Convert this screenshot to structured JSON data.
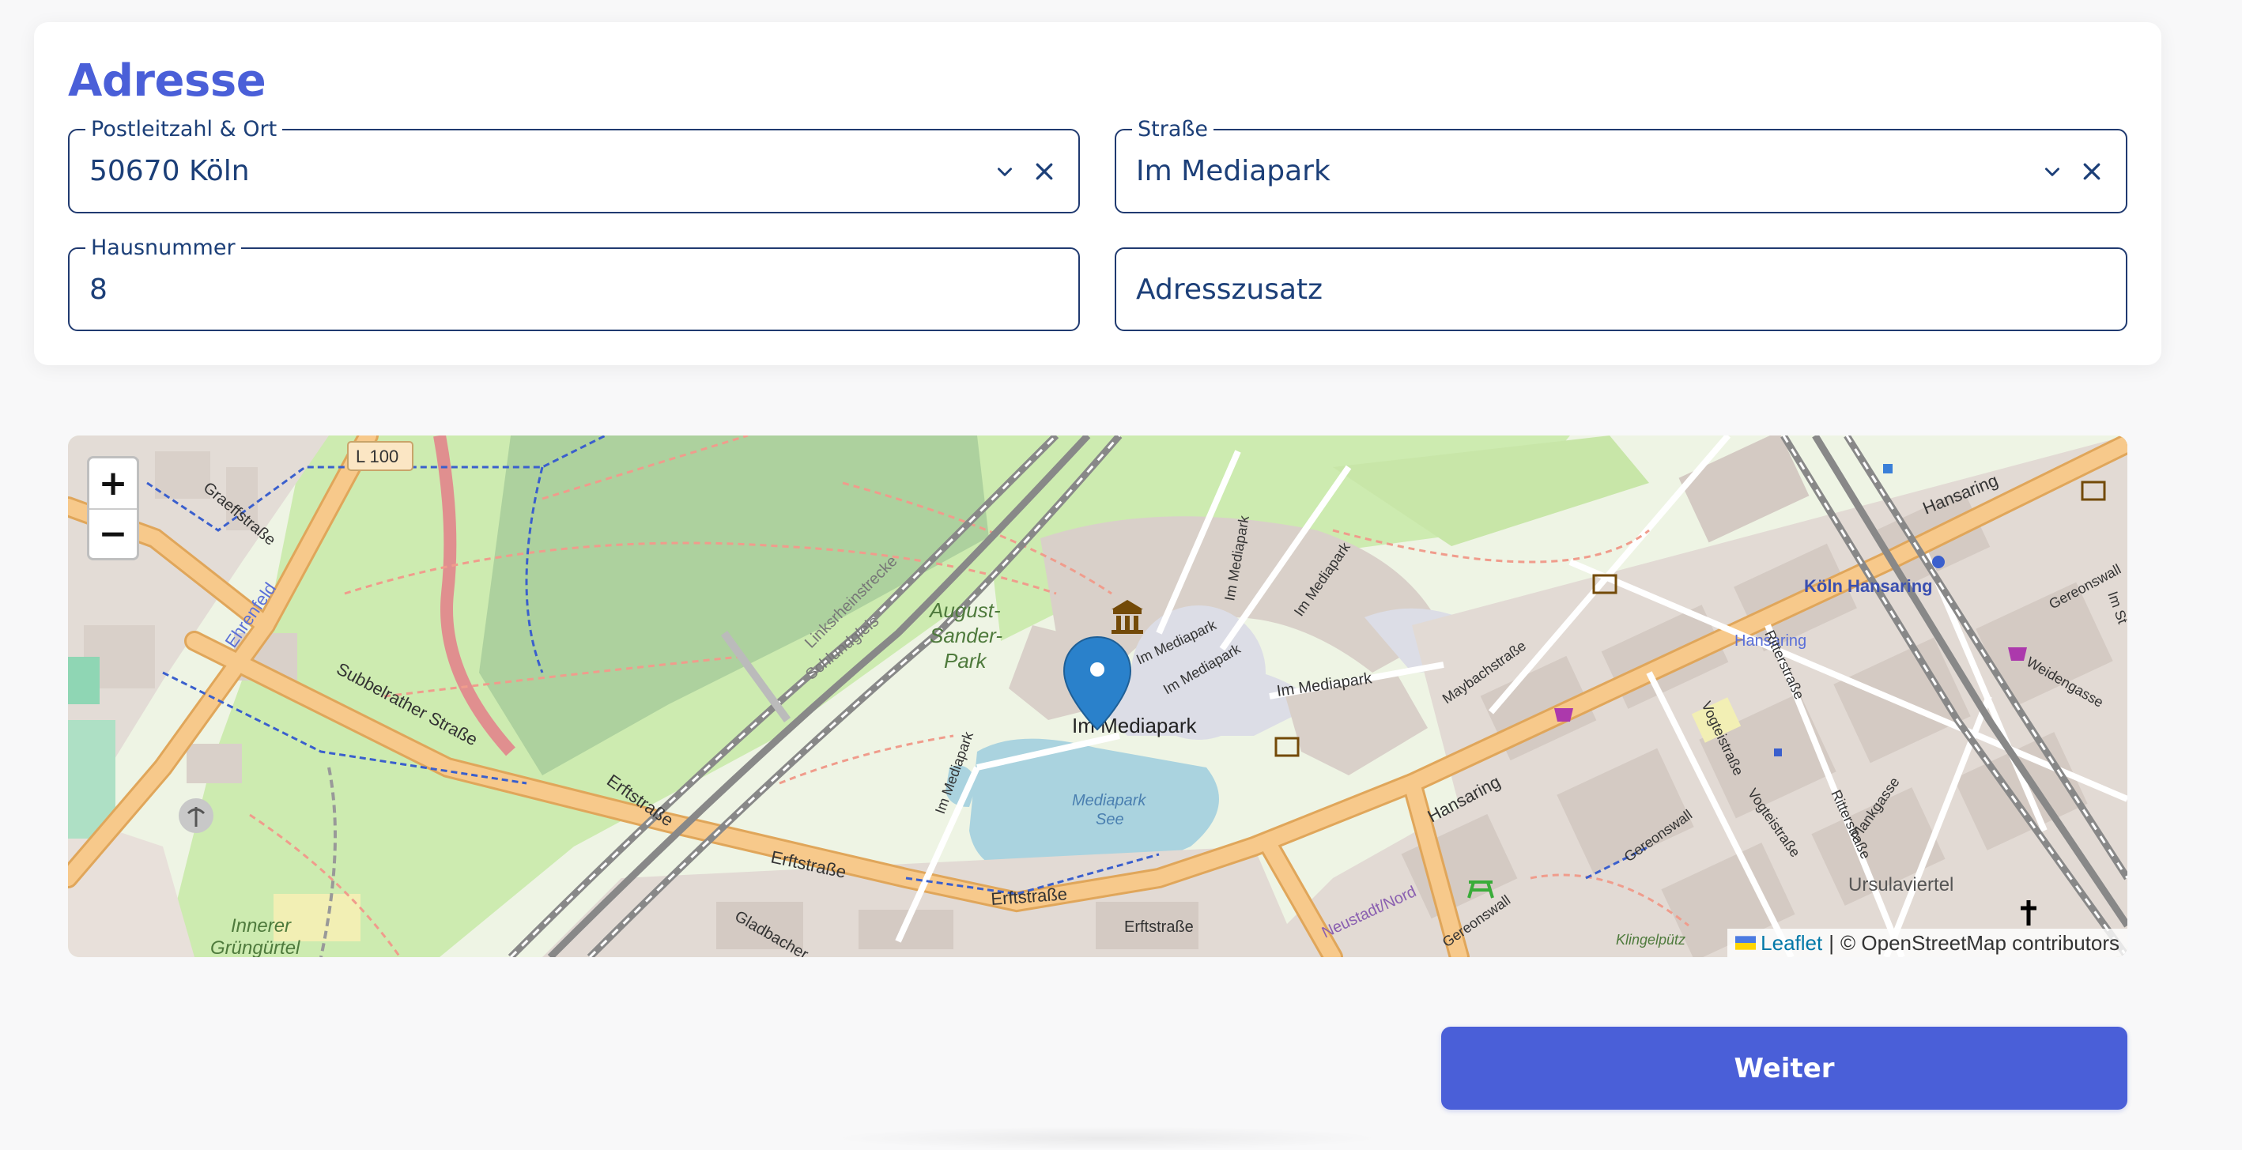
{
  "card": {
    "title": "Adresse"
  },
  "fields": {
    "plz": {
      "label": "Postleitzahl & Ort",
      "value": "50670 Köln"
    },
    "strasse": {
      "label": "Straße",
      "value": "Im Mediapark"
    },
    "hausnummer": {
      "label": "Hausnummer",
      "value": "8"
    },
    "adresszusatz": {
      "placeholder": "Adresszusatz"
    }
  },
  "map": {
    "zoom_in": "+",
    "zoom_out": "−",
    "labels": {
      "l100": "L 100",
      "graeffstrasse": "Graeffstraße",
      "ehrenfeld": "Ehrenfeld",
      "subbelrather": "Subbelrather Straße",
      "schlundgleis": "Schlundgleis",
      "linksrheinstrecke": "Linksrheinstrecke",
      "august_sander_park_1": "August-",
      "august_sander_park_2": "Sander-",
      "august_sander_park_3": "Park",
      "im_mediapark_main": "Im Mediapark",
      "im_mediapark_ring1": "Im Mediapark",
      "im_mediapark_ring2": "Im Mediapark",
      "im_mediapark_east": "Im Mediapark",
      "im_mediapark_north1": "Im Mediapark",
      "im_mediapark_north2": "Im Mediapark",
      "im_mediapark_west": "Im Mediapark",
      "mediapark_see_1": "Mediapark",
      "mediapark_see_2": "See",
      "erftstrasse_1": "Erftstraße",
      "erftstrasse_2": "Erftstraße",
      "erftstrasse_3": "Erftstraße",
      "erftstrasse_4": "Erftstraße",
      "gladbacher": "Gladbacher",
      "innerer_1": "Innerer",
      "innerer_2": "Grüngürtel",
      "maybachstrasse": "Maybachstraße",
      "hansaring_1": "Hansaring",
      "hansaring_2": "Hansaring",
      "koeln_hansaring": "Köln Hansaring",
      "hansaring_stop": "Hansaring",
      "gereonswall_1": "Gereonswall",
      "gereonswall_2": "Gereonswall",
      "gereonswall_3": "Gereonswall",
      "vogteistrasse_1": "Vogteistraße",
      "vogteistrasse_2": "Vogteistraße",
      "ritterstrasse_1": "Ritterstraße",
      "ritterstrasse_2": "Ritterstraße",
      "plankgasse": "Plankgasse",
      "weidengasse": "Weidengasse",
      "im_stavenhof": "Im St",
      "ursulaviertel": "Ursulaviertel",
      "neustadt_nord": "Neustadt/Nord",
      "klingelpuetz": "Klingelpütz"
    },
    "attribution": {
      "leaflet": "Leaflet",
      "separator": "|",
      "osm": "© OpenStreetMap contributors"
    },
    "colors": {
      "park": "#cdebb0",
      "building": "#d9d0c9",
      "major_road": "#f7c98b",
      "water": "#aad3df",
      "railway": "#777777",
      "marker": "#2a81cb"
    }
  },
  "actions": {
    "next_label": "Weiter"
  }
}
